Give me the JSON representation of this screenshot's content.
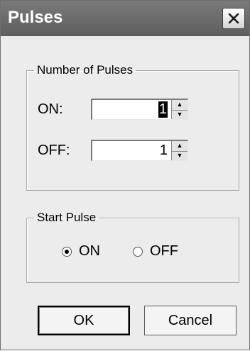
{
  "window": {
    "title": "Pulses",
    "close_icon": "close-icon"
  },
  "number_of_pulses": {
    "label": "Number of Pulses",
    "on": {
      "label": "ON:",
      "value": "1"
    },
    "off": {
      "label": "OFF:",
      "value": "1"
    }
  },
  "start_pulse": {
    "label": "Start Pulse",
    "options": [
      {
        "label": "ON",
        "checked": true
      },
      {
        "label": "OFF",
        "checked": false
      }
    ]
  },
  "buttons": {
    "ok": "OK",
    "cancel": "Cancel"
  }
}
